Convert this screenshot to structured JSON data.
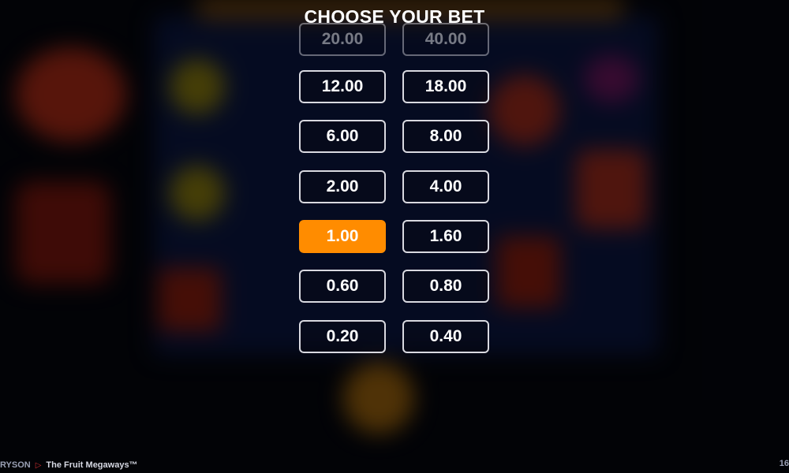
{
  "overlay": {
    "title": "CHOOSE YOUR BET"
  },
  "bets": [
    {
      "value": "20.00",
      "selected": false
    },
    {
      "value": "40.00",
      "selected": false
    },
    {
      "value": "12.00",
      "selected": false
    },
    {
      "value": "18.00",
      "selected": false
    },
    {
      "value": "6.00",
      "selected": false
    },
    {
      "value": "8.00",
      "selected": false
    },
    {
      "value": "2.00",
      "selected": false
    },
    {
      "value": "4.00",
      "selected": false
    },
    {
      "value": "1.00",
      "selected": true
    },
    {
      "value": "1.60",
      "selected": false
    },
    {
      "value": "0.60",
      "selected": false
    },
    {
      "value": "0.80",
      "selected": false
    },
    {
      "value": "0.20",
      "selected": false
    },
    {
      "value": "0.40",
      "selected": false
    }
  ],
  "footer": {
    "provider": "RYSON",
    "game_name": "The Fruit Megaways™",
    "corner_text": "16"
  },
  "colors": {
    "selected": "#ff8c00",
    "border": "#d9d9e0",
    "background": "#05070f"
  }
}
